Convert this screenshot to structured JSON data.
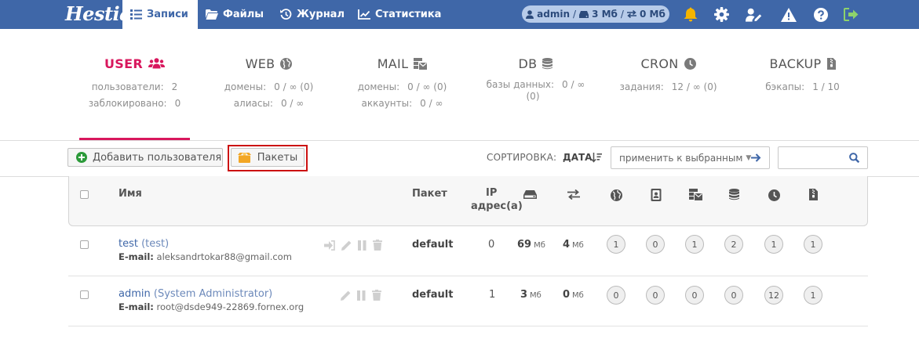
{
  "app": {
    "logo_text": "Hestia"
  },
  "nav": {
    "items": [
      {
        "label": "Записи",
        "icon": "list-icon",
        "active": true
      },
      {
        "label": "Файлы",
        "icon": "folder-icon"
      },
      {
        "label": "Журнал",
        "icon": "history-icon"
      },
      {
        "label": "Статистика",
        "icon": "chart-line-icon"
      }
    ],
    "account": {
      "user": "admin",
      "slash": "/",
      "disk": "3 Мб",
      "bandwidth": "0 Мб"
    },
    "icons": [
      "bell-icon",
      "gear-icon",
      "user-edit-icon",
      "warning-icon",
      "help-icon",
      "logout-icon"
    ]
  },
  "stats": {
    "user": {
      "title": "USER",
      "line1_label": "пользователи:",
      "line1_value": "2",
      "line2_label": "заблокировано:",
      "line2_value": "0"
    },
    "web": {
      "title": "WEB",
      "line1_label": "домены:",
      "line1_value": "0 / ∞ (0)",
      "line2_label": "алиасы:",
      "line2_value": "0 / ∞"
    },
    "mail": {
      "title": "MAIL",
      "line1_label": "домены:",
      "line1_value": "0 / ∞ (0)",
      "line2_label": "аккаунты:",
      "line2_value": "0 / ∞"
    },
    "db": {
      "title": "DB",
      "line1_label": "базы данных:",
      "line1_value": "0 / ∞",
      "line1_extra": "(0)"
    },
    "cron": {
      "title": "CRON",
      "line1_label": "задания:",
      "line1_value": "12 / ∞ (0)"
    },
    "backup": {
      "title": "BACKUP",
      "line1_label": "бэкапы:",
      "line1_value": "1 / 10"
    }
  },
  "toolbar": {
    "add_user_label": "Добавить пользователя",
    "packages_label": "Пакеты",
    "sort_label": "СОРТИРОВКА:",
    "sort_value": "ДАТА",
    "bulk_placeholder": "применить к выбранным",
    "search_value": ""
  },
  "table": {
    "headers": {
      "name": "Имя",
      "package": "Пакет",
      "ip_line1": "IP",
      "ip_line2": "адрес(а)"
    },
    "header_icons": [
      "hdd-icon",
      "bandwidth-arrows-icon",
      "globe-icon",
      "address-book-icon",
      "mail-stack-icon",
      "database-icon",
      "clock-icon",
      "file-archive-icon"
    ],
    "rows": [
      {
        "username": "test",
        "display_name": "(test)",
        "email_label": "E-mail:",
        "email": "aleksandrtokar88@gmail.com",
        "package": "default",
        "ip": "0",
        "disk_value": "69",
        "disk_unit": "Мб",
        "bw_value": "4",
        "bw_unit": "Мб",
        "web": "1",
        "dns": "0",
        "mail": "1",
        "db": "2",
        "cron": "1",
        "backup": "1"
      },
      {
        "username": "admin",
        "display_name": "(System Administrator)",
        "email_label": "E-mail:",
        "email": "root@dsde949-22869.fornex.org",
        "package": "default",
        "ip": "1",
        "disk_value": "3",
        "disk_unit": "Мб",
        "bw_value": "0",
        "bw_unit": "Мб",
        "web": "0",
        "dns": "0",
        "mail": "0",
        "db": "0",
        "cron": "12",
        "backup": "1"
      }
    ]
  },
  "colors": {
    "primary": "#3f67a8",
    "accent": "#d8175d",
    "add": "#2c9a3a",
    "package": "#f2a624",
    "highlight": "#cc1111"
  }
}
